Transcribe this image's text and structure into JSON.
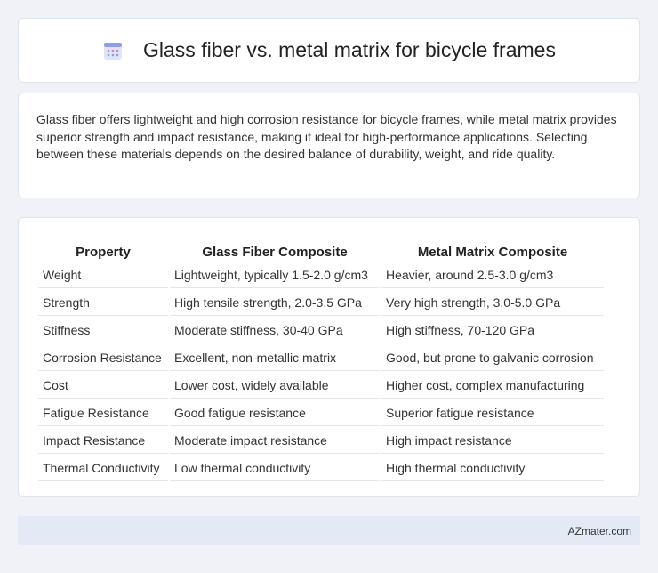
{
  "header": {
    "icon": "calendar-icon",
    "title": "Glass fiber vs. metal matrix for bicycle frames"
  },
  "summary": "Glass fiber offers lightweight and high corrosion resistance for bicycle frames, while metal matrix provides superior strength and impact resistance, making it ideal for high-performance applications. Selecting between these materials depends on the desired balance of durability, weight, and ride quality.",
  "table": {
    "headers": [
      "Property",
      "Glass Fiber Composite",
      "Metal Matrix Composite"
    ],
    "rows": [
      [
        "Weight",
        "Lightweight, typically 1.5-2.0 g/cm3",
        "Heavier, around 2.5-3.0 g/cm3"
      ],
      [
        "Strength",
        "High tensile strength, 2.0-3.5 GPa",
        "Very high strength, 3.0-5.0 GPa"
      ],
      [
        "Stiffness",
        "Moderate stiffness, 30-40 GPa",
        "High stiffness, 70-120 GPa"
      ],
      [
        "Corrosion Resistance",
        "Excellent, non-metallic matrix",
        "Good, but prone to galvanic corrosion"
      ],
      [
        "Cost",
        "Lower cost, widely available",
        "Higher cost, complex manufacturing"
      ],
      [
        "Fatigue Resistance",
        "Good fatigue resistance",
        "Superior fatigue resistance"
      ],
      [
        "Impact Resistance",
        "Moderate impact resistance",
        "High impact resistance"
      ],
      [
        "Thermal Conductivity",
        "Low thermal conductivity",
        "High thermal conductivity"
      ]
    ]
  },
  "footer": {
    "source": "AZmater.com"
  }
}
